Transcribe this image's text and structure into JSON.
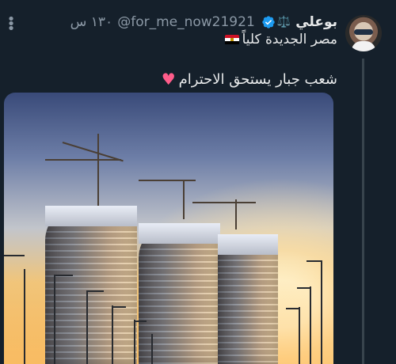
{
  "tweet": {
    "display_name": "بوعلي",
    "badge_emoji": "⚖️",
    "handle": "@for_me_now21921",
    "timestamp": "١٣٠ س",
    "subtitle": "مصر الجديدة كلياً",
    "body": "شعب جبار يستحق الاحترام"
  },
  "icons": {
    "more": "more-vertical-icon",
    "verified": "verified-badge-icon",
    "flag": "egypt-flag-icon",
    "heart": "heart-icon"
  },
  "colors": {
    "background": "#15202b",
    "text": "#e7e9ea",
    "muted": "#8b98a5",
    "thread_line": "#38444d"
  }
}
